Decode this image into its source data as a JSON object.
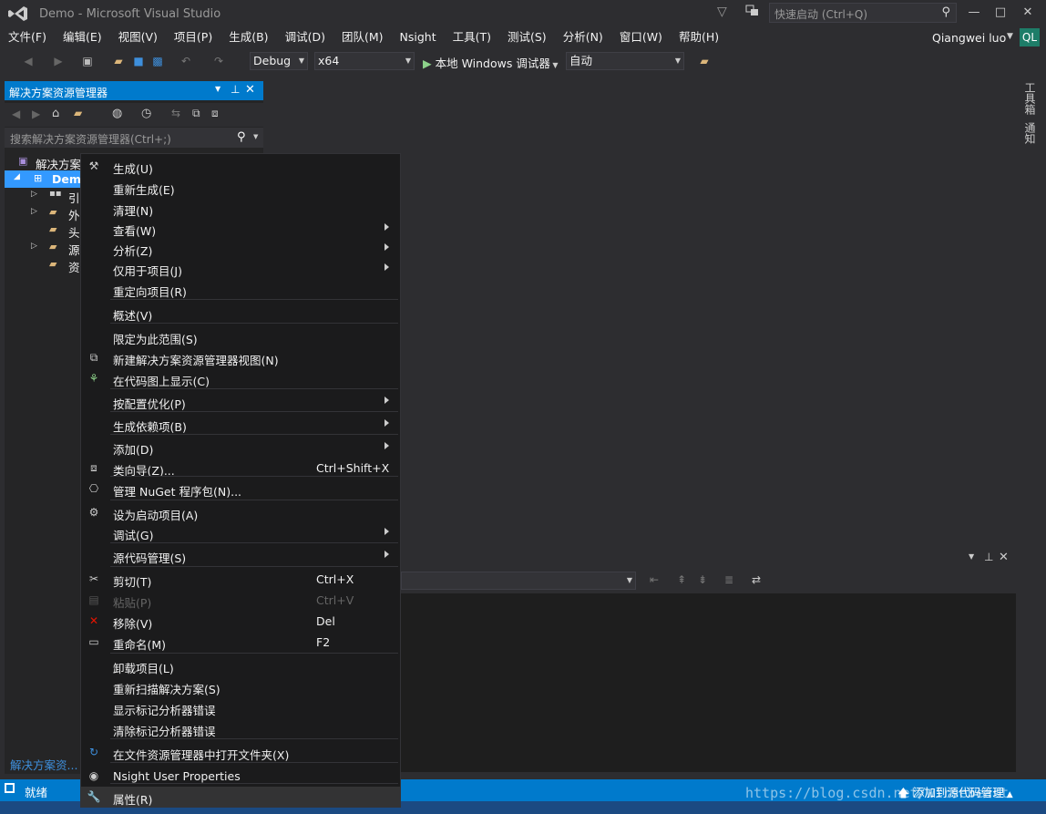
{
  "window": {
    "title": "Demo - Microsoft Visual Studio",
    "quick_launch_placeholder": "快速启动 (Ctrl+Q)",
    "minimize": "—",
    "maximize": "□",
    "close": "✕"
  },
  "menu": [
    "文件(F)",
    "编辑(E)",
    "视图(V)",
    "项目(P)",
    "生成(B)",
    "调试(D)",
    "团队(M)",
    "Nsight",
    "工具(T)",
    "测试(S)",
    "分析(N)",
    "窗口(W)",
    "帮助(H)"
  ],
  "user": {
    "name": "Qiangwei luo",
    "initials": "QL"
  },
  "toolbar": {
    "config": "Debug",
    "platform": "x64",
    "run_label": "本地 Windows 调试器",
    "run_mode": "自动"
  },
  "solution_explorer": {
    "title": "解决方案资源管理器",
    "search_placeholder": "搜索解决方案资源管理器(Ctrl+;)",
    "bottom_tab": "解决方案资...",
    "tree": [
      "解决方案",
      "Dem",
      "引",
      "外",
      "头",
      "源",
      "资"
    ]
  },
  "side_tabs": [
    "工具箱",
    "通知"
  ],
  "context_menu": [
    {
      "label": "生成(U)",
      "shortcut": "",
      "submenu": false,
      "icon": "build-icon"
    },
    {
      "label": "重新生成(E)",
      "shortcut": "",
      "submenu": false,
      "icon": ""
    },
    {
      "label": "清理(N)",
      "shortcut": "",
      "submenu": false,
      "icon": ""
    },
    {
      "label": "查看(W)",
      "shortcut": "",
      "submenu": true,
      "icon": ""
    },
    {
      "label": "分析(Z)",
      "shortcut": "",
      "submenu": true,
      "icon": ""
    },
    {
      "label": "仅用于项目(J)",
      "shortcut": "",
      "submenu": true,
      "icon": ""
    },
    {
      "label": "重定向项目(R)",
      "shortcut": "",
      "submenu": false,
      "icon": ""
    },
    {
      "label": "概述(V)",
      "shortcut": "",
      "submenu": false,
      "icon": ""
    },
    {
      "label": "限定为此范围(S)",
      "shortcut": "",
      "submenu": false,
      "icon": ""
    },
    {
      "label": "新建解决方案资源管理器视图(N)",
      "shortcut": "",
      "submenu": false,
      "icon": "new-view-icon"
    },
    {
      "label": "在代码图上显示(C)",
      "shortcut": "",
      "submenu": false,
      "icon": "code-map-icon"
    },
    {
      "label": "按配置优化(P)",
      "shortcut": "",
      "submenu": true,
      "icon": ""
    },
    {
      "label": "生成依赖项(B)",
      "shortcut": "",
      "submenu": true,
      "icon": ""
    },
    {
      "label": "添加(D)",
      "shortcut": "",
      "submenu": true,
      "icon": ""
    },
    {
      "label": "类向导(Z)...",
      "shortcut": "Ctrl+Shift+X",
      "submenu": false,
      "icon": "class-wizard-icon"
    },
    {
      "label": "管理 NuGet 程序包(N)...",
      "shortcut": "",
      "submenu": false,
      "icon": "nuget-icon"
    },
    {
      "label": "设为启动项目(A)",
      "shortcut": "",
      "submenu": false,
      "icon": "gear-icon"
    },
    {
      "label": "调试(G)",
      "shortcut": "",
      "submenu": true,
      "icon": ""
    },
    {
      "label": "源代码管理(S)",
      "shortcut": "",
      "submenu": true,
      "icon": ""
    },
    {
      "label": "剪切(T)",
      "shortcut": "Ctrl+X",
      "submenu": false,
      "icon": "scissors-icon"
    },
    {
      "label": "粘贴(P)",
      "shortcut": "Ctrl+V",
      "submenu": false,
      "icon": "paste-icon"
    },
    {
      "label": "移除(V)",
      "shortcut": "Del",
      "submenu": false,
      "icon": "remove-icon"
    },
    {
      "label": "重命名(M)",
      "shortcut": "F2",
      "submenu": false,
      "icon": "rename-icon"
    },
    {
      "label": "卸载项目(L)",
      "shortcut": "",
      "submenu": false,
      "icon": ""
    },
    {
      "label": "重新扫描解决方案(S)",
      "shortcut": "",
      "submenu": false,
      "icon": ""
    },
    {
      "label": "显示标记分析器错误",
      "shortcut": "",
      "submenu": false,
      "icon": ""
    },
    {
      "label": "清除标记分析器错误",
      "shortcut": "",
      "submenu": false,
      "icon": ""
    },
    {
      "label": "在文件资源管理器中打开文件夹(X)",
      "shortcut": "",
      "submenu": false,
      "icon": "refresh-arrow-icon"
    },
    {
      "label": "Nsight User Properties",
      "shortcut": "",
      "submenu": false,
      "icon": "nsight-icon"
    },
    {
      "label": "属性(R)",
      "shortcut": "",
      "submenu": false,
      "icon": "wrench-icon"
    }
  ],
  "status": {
    "left": "就绪",
    "right": "添加到源代码管理",
    "watermark": "https://blog.csdn.net/wirsebeast"
  }
}
